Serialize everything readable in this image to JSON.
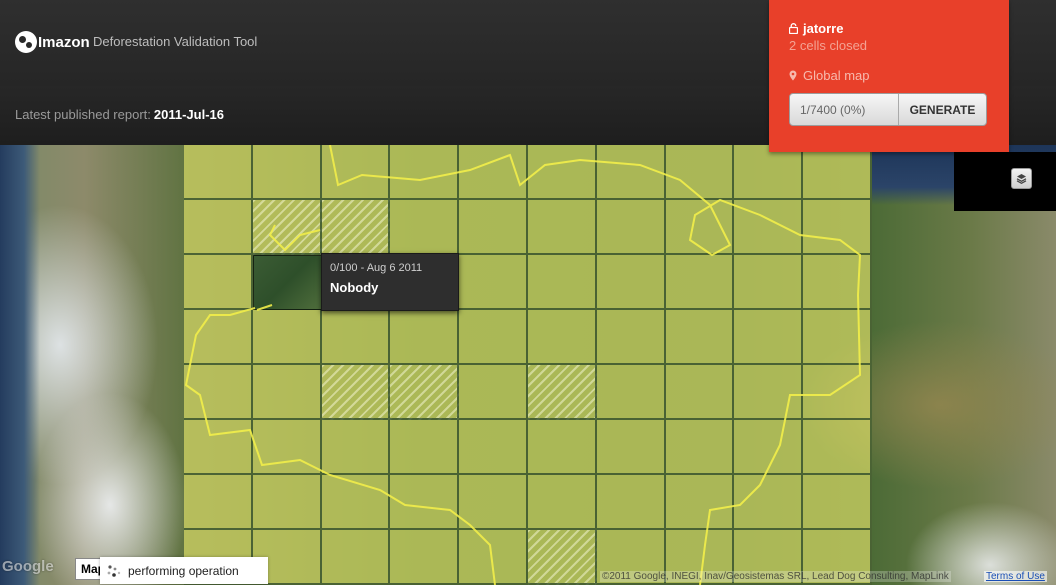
{
  "header": {
    "brand": "Imazon",
    "app_title": "Deforestation Validation Tool"
  },
  "report": {
    "label": "Latest published report:",
    "date": "2011-Jul-16"
  },
  "user_panel": {
    "username": "jatorre",
    "cells_closed": "2 cells closed",
    "map_scope": "Global map",
    "progress": "1/7400 (0%)",
    "generate_label": "GENERATE",
    "accent_color": "#e8402a"
  },
  "tooltip": {
    "meta": "0/100 - Aug 6 2011",
    "user": "Nobody"
  },
  "map": {
    "google_logo": "Google",
    "map_type_label": "Map",
    "status_text": "performing operation",
    "attribution": "©2011 Google, INEGI, Inav/Geosistemas SRL, Lead Dog Consulting, MapLink",
    "terms_label": "Terms of Use",
    "grid": {
      "columns": 10,
      "rows": 8
    },
    "overlay_color": "#eeec6e",
    "closed_cells": [
      [
        1,
        1
      ],
      [
        2,
        1
      ],
      [
        2,
        4
      ],
      [
        3,
        4
      ],
      [
        5,
        4
      ],
      [
        5,
        7
      ]
    ],
    "hover_cell": [
      1,
      2
    ]
  },
  "icons": {
    "lock": "lock-icon",
    "pin": "map-pin-icon",
    "layers": "layers-icon",
    "spinner": "spinner-icon"
  }
}
